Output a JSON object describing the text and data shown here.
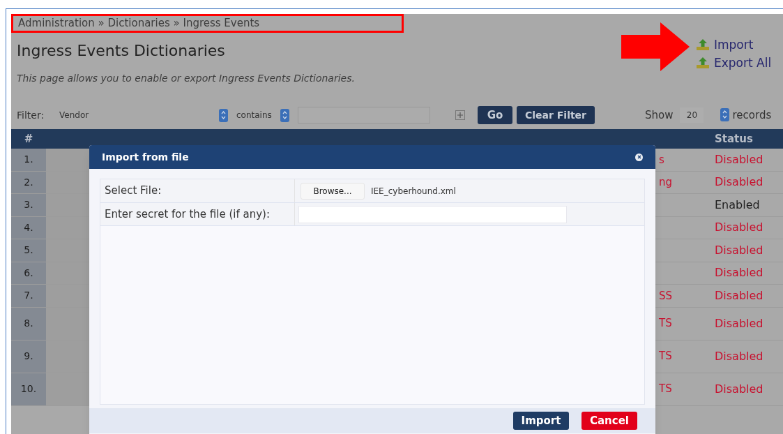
{
  "breadcrumb": "Administration » Dictionaries » Ingress Events",
  "title": "Ingress Events Dictionaries",
  "description": "This page allows you to enable or export Ingress Events Dictionaries.",
  "actions": [
    {
      "label": "Import"
    },
    {
      "label": "Export All"
    }
  ],
  "filter": {
    "label": "Filter:",
    "field": "Vendor",
    "operator": "contains",
    "go": "Go",
    "clear": "Clear Filter",
    "show_label": "Show",
    "page_size": "20",
    "records_label": "records"
  },
  "table": {
    "columns": [
      "#",
      "Status"
    ],
    "rows": [
      {
        "number": "1.",
        "column_3": "s",
        "status": "Disabled",
        "enabled": false
      },
      {
        "number": "2.",
        "column_3": "ng",
        "status": "Disabled",
        "enabled": false
      },
      {
        "number": "3.",
        "status": "Enabled",
        "enabled": true
      },
      {
        "number": "4.",
        "status": "Disabled",
        "enabled": false
      },
      {
        "number": "5.",
        "status": "Disabled",
        "enabled": false
      },
      {
        "number": "6.",
        "status": "Disabled",
        "enabled": false
      },
      {
        "number": "7.",
        "column_3": "SS",
        "status": "Disabled",
        "enabled": false
      },
      {
        "number": "8.",
        "column_3": "TS",
        "status": "Disabled",
        "enabled": false
      },
      {
        "number": "9.",
        "column_3": "TS",
        "status": "Disabled",
        "enabled": false
      },
      {
        "number": "10.",
        "column_3": "TS",
        "status": "Disabled",
        "enabled": false
      }
    ]
  },
  "dialog": {
    "title": "Import from file",
    "select_label": "Select File:",
    "browse": "Browse...",
    "file_name": "IEE_cyberhound.xml",
    "secret_label": "Enter secret for the file (if any):",
    "buttons": [
      {
        "label": "Import",
        "kind": "primary"
      },
      {
        "label": "Cancel",
        "kind": "danger"
      }
    ]
  }
}
